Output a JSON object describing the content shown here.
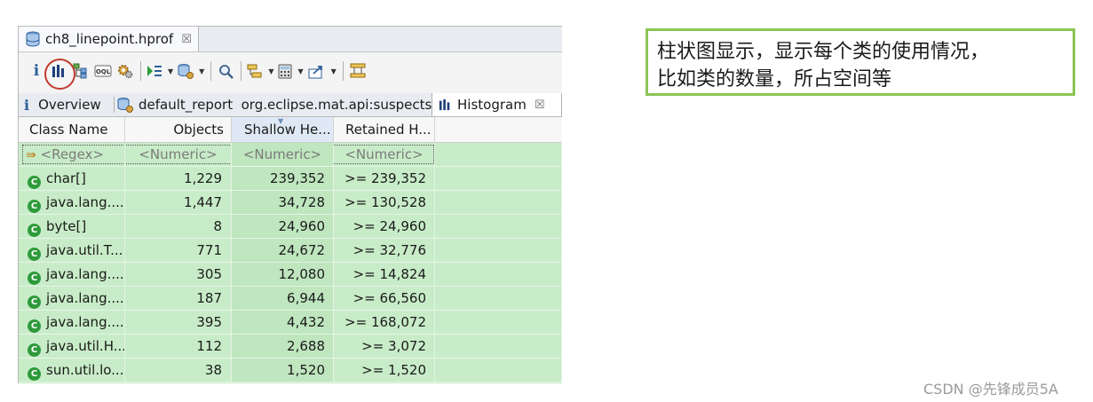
{
  "editor_tab": {
    "label": "ch8_linepoint.hprof",
    "close": "☒"
  },
  "view_tabs": [
    {
      "label": "Overview"
    },
    {
      "label": "default_report  org.eclipse.mat.api:suspects"
    },
    {
      "label": "Histogram",
      "close": "☒"
    }
  ],
  "columns": [
    "Class Name",
    "Objects",
    "Shallow He...",
    "Retained H..."
  ],
  "filter_row": [
    "<Regex>",
    "<Numeric>",
    "<Numeric>",
    "<Numeric>"
  ],
  "rows": [
    {
      "name": "char[]",
      "objects": "1,229",
      "shallow": "239,352",
      "retained": ">= 239,352"
    },
    {
      "name": "java.lang....",
      "objects": "1,447",
      "shallow": "34,728",
      "retained": ">= 130,528"
    },
    {
      "name": "byte[]",
      "objects": "8",
      "shallow": "24,960",
      "retained": ">= 24,960"
    },
    {
      "name": "java.util.T...",
      "objects": "771",
      "shallow": "24,672",
      "retained": ">= 32,776"
    },
    {
      "name": "java.lang....",
      "objects": "305",
      "shallow": "12,080",
      "retained": ">= 14,824"
    },
    {
      "name": "java.lang....",
      "objects": "187",
      "shallow": "6,944",
      "retained": ">= 66,560"
    },
    {
      "name": "java.lang....",
      "objects": "395",
      "shallow": "4,432",
      "retained": ">= 168,072"
    },
    {
      "name": "java.util.H...",
      "objects": "112",
      "shallow": "2,688",
      "retained": ">= 3,072"
    },
    {
      "name": "sun.util.lo...",
      "objects": "38",
      "shallow": "1,520",
      "retained": ">= 1,520"
    }
  ],
  "annotation": {
    "line1": "柱状图显示，显示每个类的使用情况，",
    "line2": "比如类的数量，所占空间等"
  },
  "watermark": "CSDN @先锋成员5A",
  "colors": {
    "table_bg": "#c8ecc8",
    "highlight_ring": "#c0392b",
    "note_border": "#8dc455",
    "class_icon": "#2e9a3a"
  }
}
